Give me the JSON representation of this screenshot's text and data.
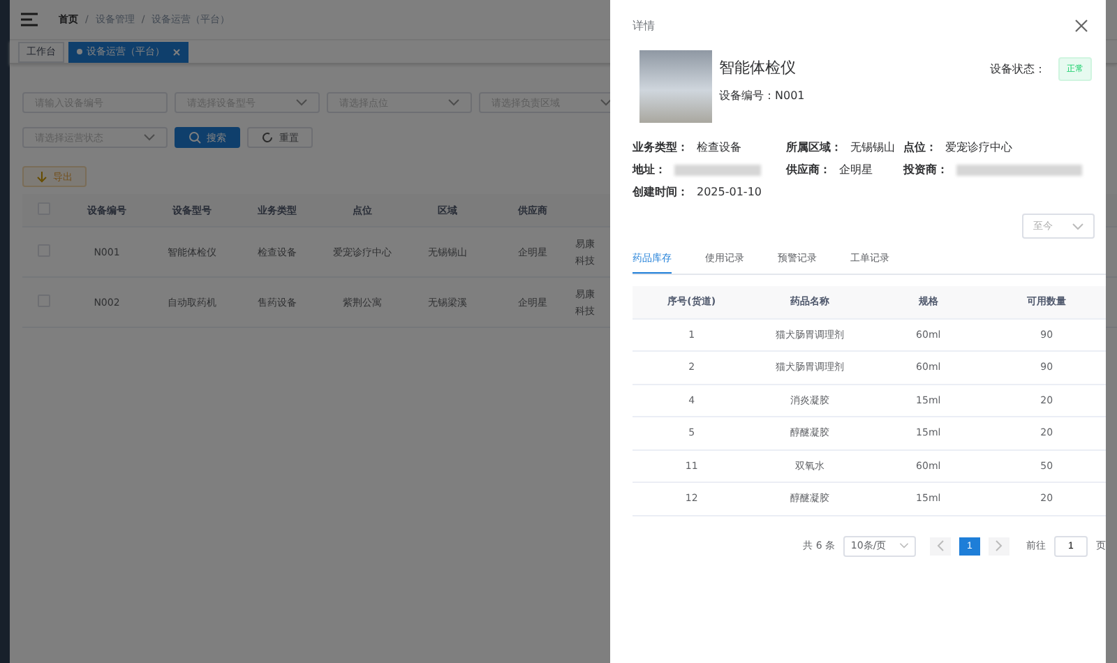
{
  "breadcrumb": [
    "首页",
    "设备管理",
    "设备运营（平台）"
  ],
  "breadcrumb_separator": "/",
  "tags": [
    {
      "label": "工作台",
      "selected": false
    },
    {
      "label": "设备运营（平台）",
      "selected": true,
      "closable": true
    }
  ],
  "filters": [
    {
      "placeholder": "请输入设备编号",
      "kind": "input"
    },
    {
      "placeholder": "请选择设备型号",
      "kind": "select"
    },
    {
      "placeholder": "请选择点位",
      "kind": "select"
    },
    {
      "placeholder": "请选择负责区域",
      "kind": "select"
    },
    {
      "placeholder": "请选择运营状态",
      "kind": "select"
    }
  ],
  "search_button": "搜索",
  "reset_button": "重置",
  "export_button": "导出",
  "table": {
    "all_checked": false,
    "columns": [
      "设备编号",
      "设备型号",
      "业务类型",
      "点位",
      "区域",
      "供应商"
    ],
    "rows": [
      {
        "cells": [
          "N001",
          "智能体检仪",
          "检查设备",
          "爱宠诊疗中心",
          "无锡锡山",
          "企明星",
          "易康科技"
        ],
        "checked": false
      },
      {
        "cells": [
          "N002",
          "自动取药机",
          "售药设备",
          "紫荆公寓",
          "无锡梁溪",
          "企明星",
          "易康科技"
        ],
        "checked": false
      }
    ]
  },
  "drawer": {
    "title": "详情",
    "device": {
      "name": "智能体检仪",
      "code_label": "设备编号：",
      "code": "N001",
      "status_label": "设备状态：",
      "status": "正常"
    },
    "info": [
      {
        "label": "业务类型：",
        "value": "检查设备",
        "kind": "text"
      },
      {
        "label": "所属区域：",
        "value": "无锡锡山",
        "kind": "text"
      },
      {
        "label": "点位：",
        "value": "爱宠诊疗中心",
        "kind": "text"
      },
      {
        "label": "地址：",
        "kind": "redacted"
      },
      {
        "label": "供应商：",
        "value": "企明星",
        "kind": "text"
      },
      {
        "label": "投资商：",
        "kind": "redacted"
      },
      {
        "label": "创建时间：",
        "value": "2025-01-10",
        "kind": "text"
      }
    ],
    "period": "至今",
    "tabs": [
      {
        "label": "药品库存",
        "selected": true
      },
      {
        "label": "使用记录",
        "selected": false
      },
      {
        "label": "预警记录",
        "selected": false
      },
      {
        "label": "工单记录",
        "selected": false
      }
    ],
    "table": {
      "columns": [
        "序号(货道)",
        "药品名称",
        "规格",
        "可用数量"
      ],
      "rows": [
        [
          "1",
          "猫犬肠胃调理剂",
          "60ml",
          "90"
        ],
        [
          "2",
          "猫犬肠胃调理剂",
          "60ml",
          "90"
        ],
        [
          "4",
          "消炎凝胶",
          "15ml",
          "20"
        ],
        [
          "5",
          "醇醚凝胶",
          "15ml",
          "20"
        ],
        [
          "11",
          "双氧水",
          "60ml",
          "50"
        ],
        [
          "12",
          "醇醚凝胶",
          "15ml",
          "20"
        ]
      ]
    },
    "pagination": {
      "total": "共 6 条",
      "page_size": "10条/页",
      "pages": [
        {
          "label": "1",
          "selected": true
        }
      ],
      "goto_label": "前往",
      "goto_value": "1",
      "goto_suffix": "页"
    }
  }
}
